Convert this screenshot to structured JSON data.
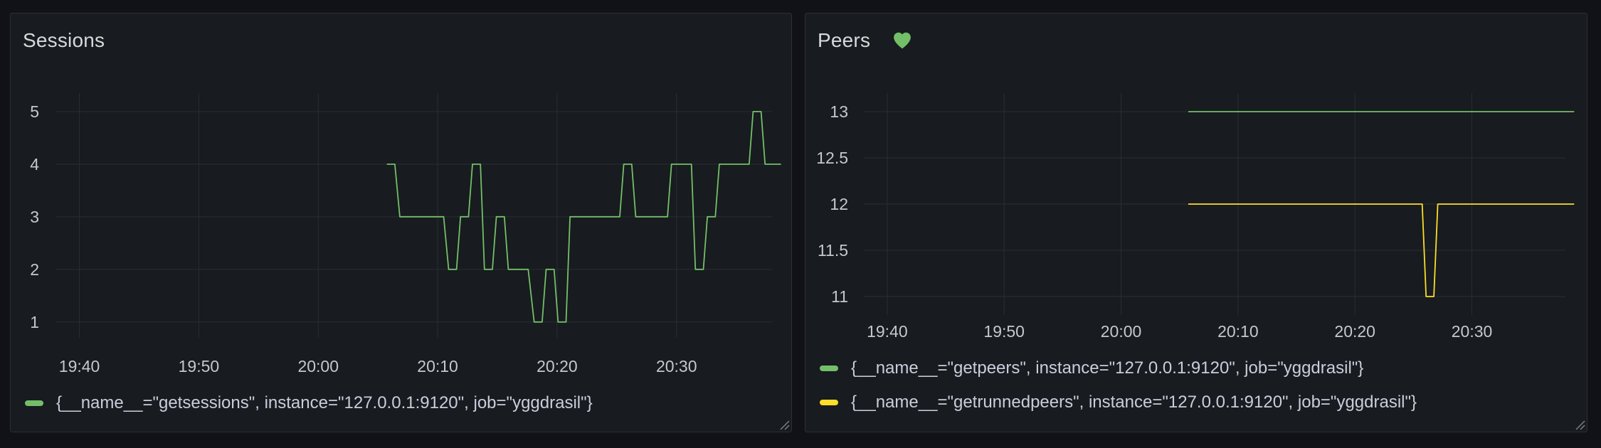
{
  "panels": [
    {
      "title": "Sessions",
      "has_heart_icon": false,
      "legend": [
        {
          "label": "{__name__=\"getsessions\", instance=\"127.0.0.1:9120\", job=\"yggdrasil\"}",
          "color": "#73bf69"
        }
      ]
    },
    {
      "title": "Peers",
      "has_heart_icon": true,
      "heart_color": "#73bf69",
      "legend": [
        {
          "label": "{__name__=\"getpeers\", instance=\"127.0.0.1:9120\", job=\"yggdrasil\"}",
          "color": "#73bf69"
        },
        {
          "label": "{__name__=\"getrunnedpeers\", instance=\"127.0.0.1:9120\", job=\"yggdrasil\"}",
          "color": "#fade2a"
        }
      ]
    }
  ],
  "chart_data": [
    {
      "type": "line",
      "title": "Sessions",
      "x_ticks": [
        "19:40",
        "19:50",
        "20:00",
        "20:10",
        "20:20",
        "20:30"
      ],
      "y_ticks": [
        1,
        2,
        3,
        4,
        5
      ],
      "xlim": [
        "19:38",
        "20:38"
      ],
      "ylim": [
        0.7,
        5.35
      ],
      "grid": true,
      "legend_position": "bottom",
      "series": [
        {
          "name": "{__name__=\"getsessions\", instance=\"127.0.0.1:9120\", job=\"yggdrasil\"}",
          "color": "#73bf69",
          "x": [
            "20:05:45",
            "20:06:25",
            "20:06:50",
            "20:10:30",
            "20:10:55",
            "20:11:35",
            "20:11:55",
            "20:12:35",
            "20:12:55",
            "20:13:35",
            "20:13:55",
            "20:14:35",
            "20:14:55",
            "20:15:35",
            "20:15:55",
            "20:17:35",
            "20:18:05",
            "20:18:45",
            "20:19:05",
            "20:19:45",
            "20:20:05",
            "20:20:45",
            "20:21:05",
            "20:25:15",
            "20:25:35",
            "20:26:15",
            "20:26:35",
            "20:29:15",
            "20:29:35",
            "20:31:15",
            "20:31:35",
            "20:32:15",
            "20:32:35",
            "20:33:15",
            "20:33:35",
            "20:36:05",
            "20:36:25",
            "20:37:05",
            "20:37:25",
            "20:38:45"
          ],
          "values": [
            4,
            4,
            3,
            3,
            2,
            2,
            3,
            3,
            4,
            4,
            2,
            2,
            3,
            3,
            2,
            2,
            1,
            1,
            2,
            2,
            1,
            1,
            3,
            3,
            4,
            4,
            3,
            3,
            4,
            4,
            2,
            2,
            3,
            3,
            4,
            4,
            5,
            5,
            4,
            4
          ]
        }
      ]
    },
    {
      "type": "line",
      "title": "Peers",
      "x_ticks": [
        "19:40",
        "19:50",
        "20:00",
        "20:10",
        "20:20",
        "20:30"
      ],
      "y_ticks": [
        11,
        11.5,
        12,
        12.5,
        13
      ],
      "xlim": [
        "19:38",
        "20:38"
      ],
      "ylim": [
        10.8,
        13.2
      ],
      "grid": true,
      "legend_position": "bottom",
      "series": [
        {
          "name": "{__name__=\"getpeers\", instance=\"127.0.0.1:9120\", job=\"yggdrasil\"}",
          "color": "#73bf69",
          "x": [
            "20:05:45",
            "20:38:45"
          ],
          "values": [
            13,
            13
          ]
        },
        {
          "name": "{__name__=\"getrunnedpeers\", instance=\"127.0.0.1:9120\", job=\"yggdrasil\"}",
          "color": "#fade2a",
          "x": [
            "20:05:45",
            "20:25:45",
            "20:26:05",
            "20:26:45",
            "20:27:05",
            "20:38:45"
          ],
          "values": [
            12,
            12,
            11,
            11,
            12,
            12
          ]
        }
      ]
    }
  ]
}
